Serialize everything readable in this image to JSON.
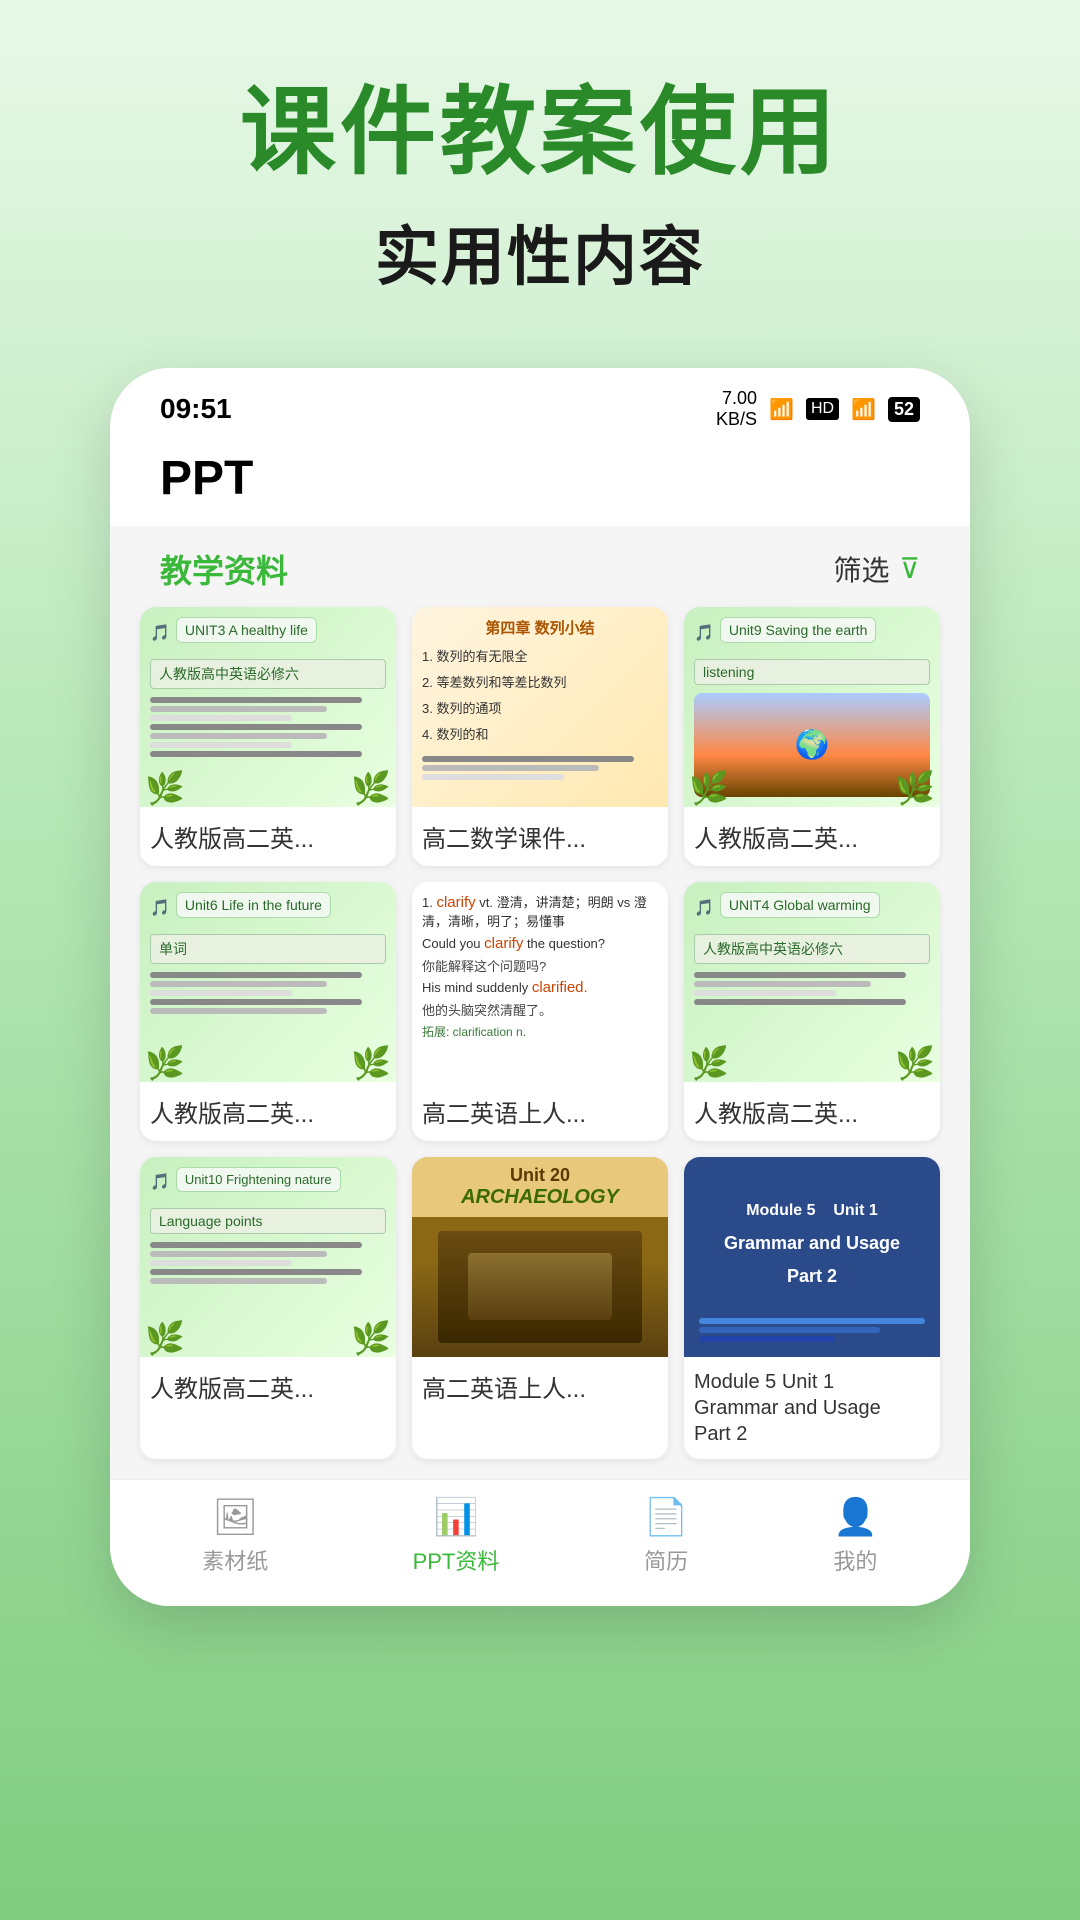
{
  "hero": {
    "title": "课件教案使用",
    "subtitle": "实用性内容"
  },
  "status_bar": {
    "time": "09:51",
    "speed": "7.00\nKB/S",
    "battery": "52"
  },
  "app": {
    "title": "PPT",
    "filter_section": "教学资料",
    "filter_button": "筛选"
  },
  "nav": {
    "items": [
      {
        "label": "素材纸",
        "icon": "🖼",
        "active": false
      },
      {
        "label": "PPT资料",
        "icon": "📊",
        "active": true
      },
      {
        "label": "简历",
        "icon": "📄",
        "active": false
      },
      {
        "label": "我的",
        "icon": "👤",
        "active": false
      }
    ]
  },
  "cards": [
    {
      "label": "人教版高二英...",
      "thumb_type": "green_unit3",
      "thumb_title": "UNIT3 A healthy life",
      "thumb_sub": "人教版高中英语必修六"
    },
    {
      "label": "高二数学课件...",
      "thumb_type": "orange_math",
      "thumb_title": "第四章 数列小结",
      "thumb_items": [
        "1. 数列的有无限全",
        "2. 等差数列和等差比数列",
        "3. 数列的通项",
        "4. 数列的和"
      ]
    },
    {
      "label": "人教版高二英...",
      "thumb_type": "green_unit9",
      "thumb_title": "Unit9 Saving the earth",
      "thumb_sub": "listening"
    },
    {
      "label": "人教版高二英...",
      "thumb_type": "green_unit6",
      "thumb_title": "Unit6 Life in the future",
      "thumb_sub": "单词"
    },
    {
      "label": "高二英语上人...",
      "thumb_type": "word_clarify",
      "thumb_title": "1. clarify vt. 澄清，讲清楚；明朗 vs 澄清，清晰，明了；易懂事"
    },
    {
      "label": "人教版高二英...",
      "thumb_type": "green_unit4",
      "thumb_title": "UNIT4 Global warming",
      "thumb_sub": "人教版高中英语必修六"
    },
    {
      "label": "人教版高二英...",
      "thumb_type": "green_unit10",
      "thumb_title": "Unit10 Frightening nature",
      "thumb_sub": "Language points"
    },
    {
      "label": "高二英语上人...",
      "thumb_type": "archaeology",
      "thumb_title": "Unit 20\nARCHAEOLOGY"
    },
    {
      "label": "Module 5 Unit 1\nGrammar and Usage\nPart 2",
      "thumb_type": "module5",
      "thumb_title": "Module 5   Unit 1\n\nGrammar and Usage\nPart 2"
    }
  ]
}
